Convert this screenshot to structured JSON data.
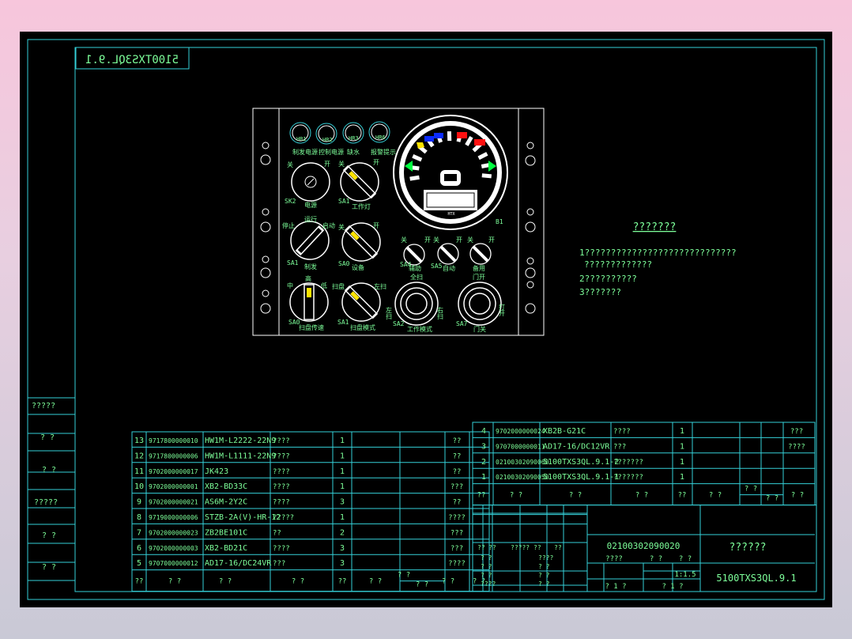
{
  "drawing": {
    "mirrored_title": "5100TXS3QL.9.1",
    "right_note": {
      "title": "???????",
      "lines": [
        "1?????????????????????????????",
        "?????????????",
        "2??????????",
        "3???????"
      ]
    },
    "left_column_labels": [
      "?????",
      "? ?",
      "? ?",
      "?????",
      "? ?",
      "? ?"
    ]
  },
  "panel": {
    "indicators": [
      {
        "code": "HR1",
        "label": "制发电源"
      },
      {
        "code": "HR2",
        "label": "控制电源"
      },
      {
        "code": "HR3",
        "label": "缺水"
      },
      {
        "code": "HR6",
        "label": "报警提示"
      }
    ],
    "switches": [
      {
        "code": "SK2",
        "label": "电源",
        "left": "关",
        "right": "开"
      },
      {
        "code": "SA1",
        "label": "工作灯",
        "left": "关",
        "right": "开"
      },
      {
        "code": "SA1",
        "label": "制发",
        "left": "停止",
        "top": "运行",
        "right": "启动"
      },
      {
        "code": "SA0",
        "label": "设备",
        "left": "关",
        "right": "开"
      },
      {
        "code": "SA0",
        "label": "扫盘传速",
        "left": "中",
        "top": "高",
        "right": "低"
      },
      {
        "code": "SA1",
        "label": "扫盘模式",
        "left": "扫盘",
        "right": "左扫"
      },
      {
        "code": "SA4",
        "label": "辅助",
        "left": "关",
        "right": "开"
      },
      {
        "code": "SA5",
        "label": "自动",
        "left": "关",
        "right": "开"
      },
      {
        "code": "SA6",
        "label": "备用",
        "left": "关",
        "right": "开"
      },
      {
        "code": "SA2",
        "label": "工作模式",
        "top": "全扫",
        "left": "左扫",
        "right": "右扫"
      },
      {
        "code": "SA7",
        "label": "门关",
        "top": "门开",
        "right": "打开"
      }
    ],
    "gauge": {
      "code": "B1",
      "brand": "HTX"
    }
  },
  "bom_left": {
    "rows": [
      {
        "no": "13",
        "code": "9717800000010",
        "model": "HW1M-L2222-22N9",
        "name": "????",
        "qty": "1",
        "note": "??"
      },
      {
        "no": "12",
        "code": "9717800000006",
        "model": "HW1M-L1111-22N9",
        "name": "????",
        "qty": "1",
        "note": "??"
      },
      {
        "no": "11",
        "code": "9702000000017",
        "model": "JK423",
        "name": "????",
        "qty": "1",
        "note": "??"
      },
      {
        "no": "10",
        "code": "9702000000001",
        "model": "XB2-BD33C",
        "name": "????",
        "qty": "1",
        "note": "???"
      },
      {
        "no": "9",
        "code": "9702000000021",
        "model": "AS6M-2Y2C",
        "name": "????",
        "qty": "3",
        "note": "??"
      },
      {
        "no": "8",
        "code": "9719000000006",
        "model": "STZB-2A(V)-HR-12",
        "name": "?????",
        "qty": "1",
        "note": "????"
      },
      {
        "no": "7",
        "code": "9702000000023",
        "model": "ZB2BE101C",
        "name": "??",
        "qty": "2",
        "note": "???"
      },
      {
        "no": "6",
        "code": "9702000000003",
        "model": "XB2-BD21C",
        "name": "????",
        "qty": "3",
        "note": "???"
      },
      {
        "no": "5",
        "code": "9707000000012",
        "model": "AD17-16/DC24VR",
        "name": "???",
        "qty": "3",
        "note": "????"
      }
    ],
    "header": [
      "??",
      "? ?",
      "? ?",
      "? ?",
      "??",
      "? ?",
      "? ?",
      "? ?",
      "? ?",
      "? ?"
    ]
  },
  "bom_right": {
    "rows": [
      {
        "no": "4",
        "code": "9702000000024",
        "model": "XB2B-G21C",
        "name": "????",
        "qty": "1",
        "note": "???"
      },
      {
        "no": "3",
        "code": "9707000000011",
        "model": "AD17-16/DC12VR",
        "name": "???",
        "qty": "1",
        "note": "????"
      },
      {
        "no": "2",
        "code": "02100302090060",
        "model": "5100TXS3QL.9.1-2",
        "name": "???????",
        "qty": "1",
        "note": ""
      },
      {
        "no": "1",
        "code": "02100302090050",
        "model": "5100TXS3QL.9.1-1",
        "name": "???????",
        "qty": "1",
        "note": ""
      }
    ],
    "header": [
      "??",
      "? ?",
      "? ?",
      "? ?",
      "??",
      "? ?",
      "? ?",
      "? ?",
      "? ?"
    ]
  },
  "title_block": {
    "drawing_code": "02100302090020",
    "drawing_name": "??????",
    "drawing_no": "5100TXS3QL.9.1",
    "scale": "1:1.5",
    "stage_labels": [
      "????",
      "? ?",
      "? ?"
    ],
    "sheet_labels": [
      "? 1 ?",
      "? 1 ?"
    ],
    "rev_header": [
      "??",
      "??",
      "?????",
      "??",
      "??"
    ],
    "sign_rows": [
      [
        "? ?",
        "????"
      ],
      [
        "? ?",
        "? ?"
      ],
      [
        "? ?",
        "? ?"
      ],
      [
        "????",
        "? ?"
      ]
    ]
  },
  "colors": {
    "frame": "#35d0d8",
    "text": "#7dff9a",
    "panel": "#ffffff",
    "background": "#000000"
  }
}
